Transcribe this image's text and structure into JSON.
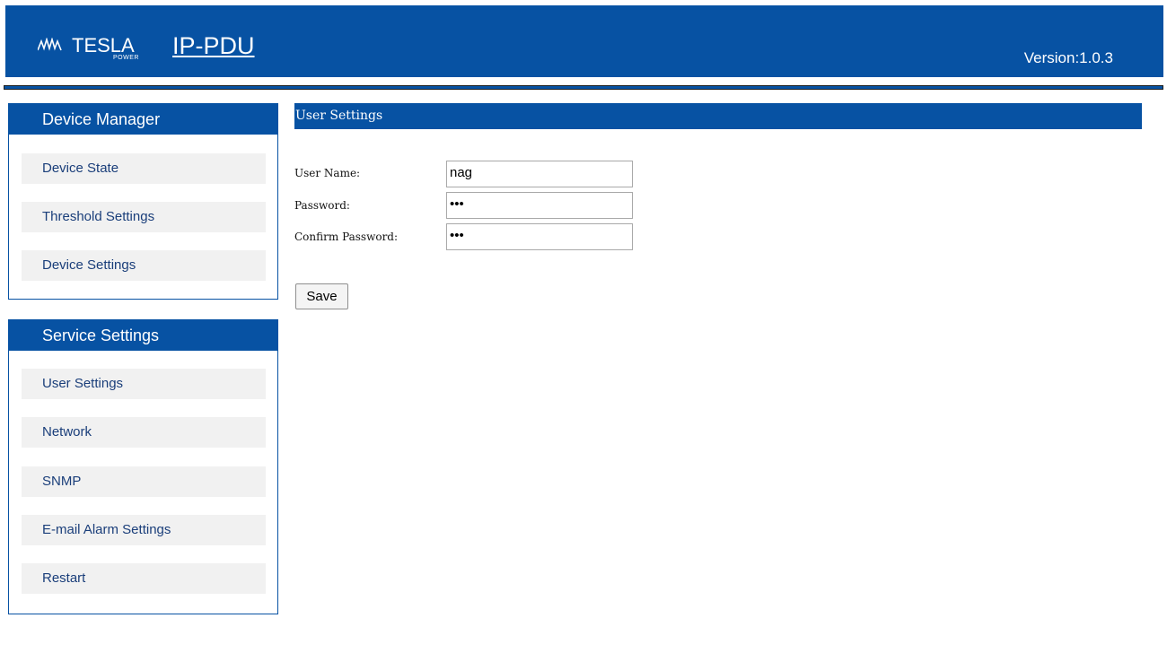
{
  "header": {
    "logo_text": "TESLA",
    "logo_sub": "POWER",
    "app_title": "IP-PDU",
    "version": "Version:1.0.3"
  },
  "sidebar": {
    "device_manager": {
      "title": "Device Manager",
      "items": [
        "Device State",
        "Threshold Settings",
        "Device Settings"
      ]
    },
    "service_settings": {
      "title": "Service Settings",
      "items": [
        "User Settings",
        "Network",
        "SNMP",
        "E-mail Alarm Settings",
        "Restart"
      ]
    }
  },
  "main": {
    "section_title": "User Settings",
    "form": {
      "username_label": "User Name:",
      "username_value": "nag",
      "password_label": "Password:",
      "password_value": "•••",
      "confirm_label": "Confirm Password:",
      "confirm_value": "•••",
      "save_label": "Save"
    }
  },
  "colors": {
    "brand_blue": "#0752a3",
    "item_bg": "#f1f1f1",
    "item_text": "#1a3e7a"
  }
}
